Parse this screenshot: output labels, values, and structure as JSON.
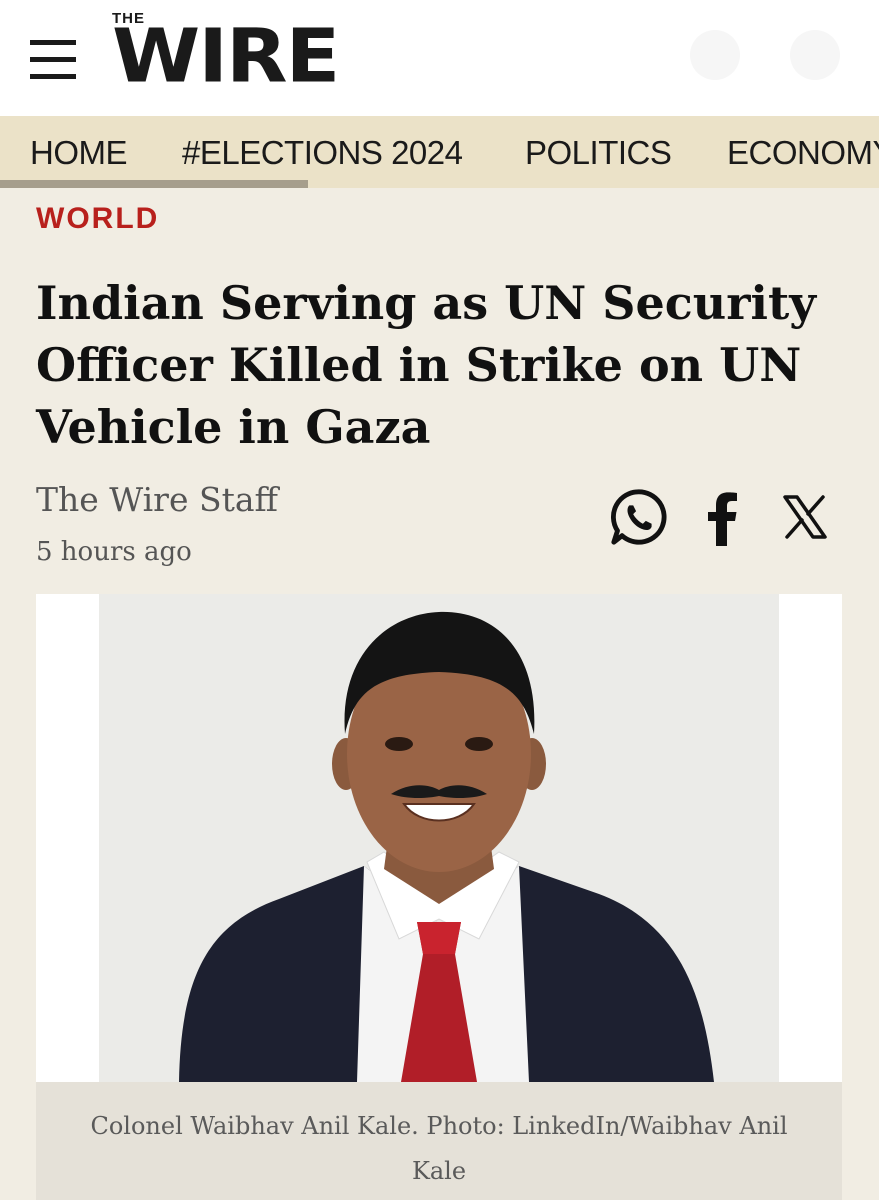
{
  "header": {
    "menu_icon": "hamburger-menu-icon",
    "logo_small": "THE",
    "logo_main": "WIRE"
  },
  "nav": {
    "items": [
      {
        "label": "HOME"
      },
      {
        "label": "#ELECTIONS 2024"
      },
      {
        "label": "POLITICS"
      },
      {
        "label": "ECONOMY"
      }
    ]
  },
  "article": {
    "category": "WORLD",
    "headline": "Indian Serving as UN Security Officer Killed in Strike on UN Vehicle in Gaza",
    "author": "The Wire Staff",
    "timestamp": "5 hours ago",
    "share": {
      "whatsapp_icon": "whatsapp-icon",
      "facebook_icon": "facebook-icon",
      "x_icon": "x-icon"
    },
    "photo_caption": "Colonel Waibhav Anil Kale. Photo: LinkedIn/Waibhav Anil Kale"
  },
  "colors": {
    "accent_red": "#b8201c",
    "nav_background": "#ebe2c8",
    "page_background": "#f1ede3"
  }
}
